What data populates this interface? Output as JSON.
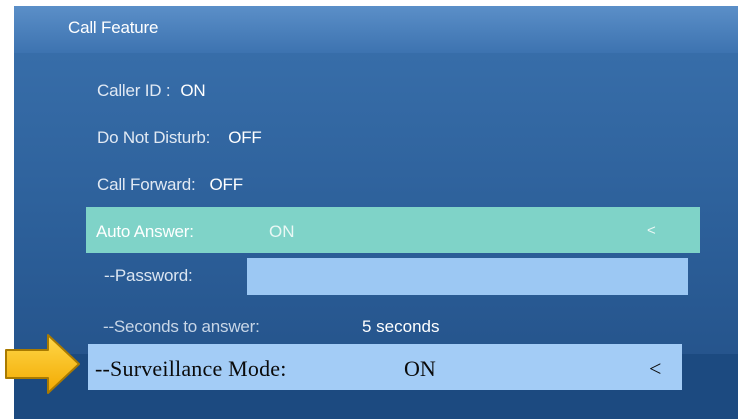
{
  "window": {
    "title": "Call Feature"
  },
  "settings": [
    {
      "label": "Caller ID :",
      "value": "ON"
    },
    {
      "label": "Do Not Disturb:",
      "value": "OFF"
    },
    {
      "label": "Call Forward:",
      "value": "OFF"
    }
  ],
  "auto_answer": {
    "label": "Auto Answer:",
    "value": "ON",
    "caret": "<"
  },
  "password": {
    "label": "--Password:",
    "value": ""
  },
  "seconds_to_answer": {
    "label": "--Seconds to answer:",
    "value": "5 seconds"
  },
  "surveillance_mode": {
    "label": "--Surveillance Mode:",
    "value": "ON",
    "caret": "<"
  },
  "colors": {
    "panel": "#2c5f99",
    "titlebar": "#4a80bd",
    "selected_row": "#7fd3c8",
    "password_field": "#9cc8f3",
    "highlight_row": "#a3ccf6",
    "arrow": "#f5b800"
  },
  "icons": {
    "pointer": "arrow-right-icon"
  }
}
